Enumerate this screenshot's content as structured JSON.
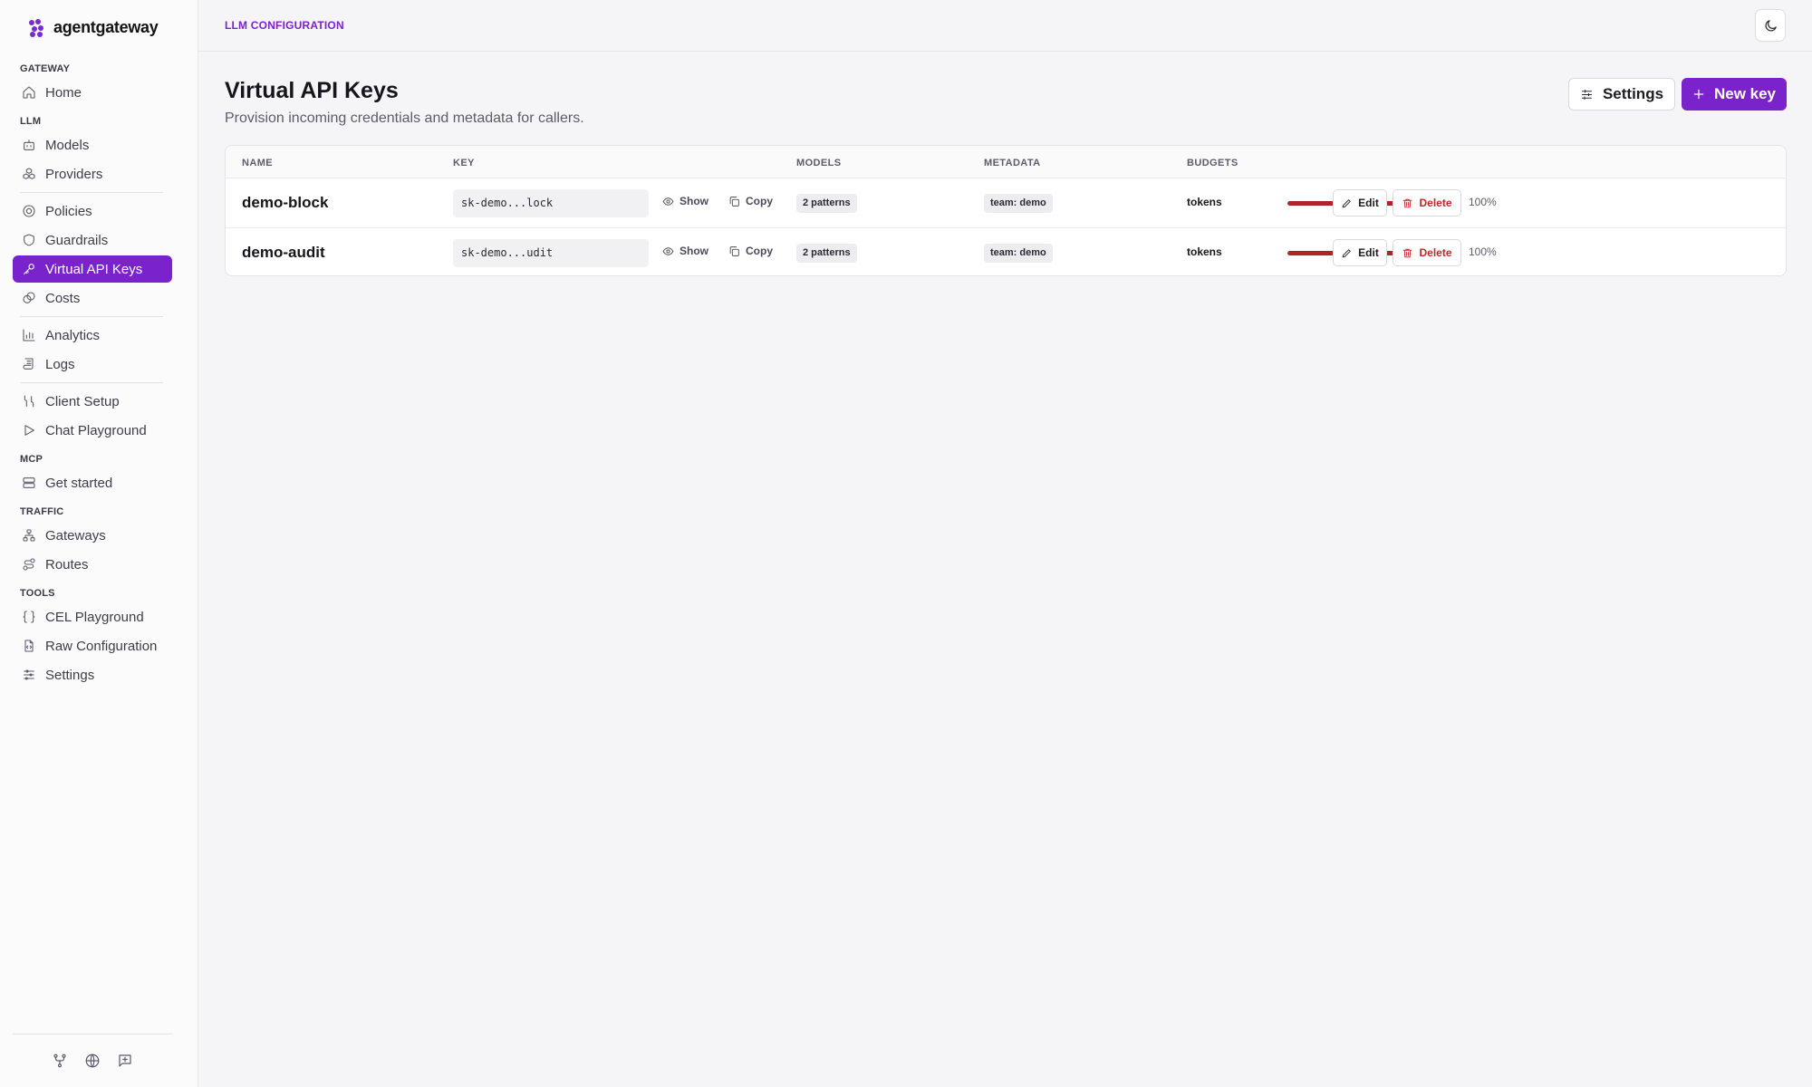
{
  "app": {
    "brand": "agentgateway"
  },
  "sidebar": {
    "sections": {
      "gateway": "GATEWAY",
      "llm": "LLM",
      "mcp": "MCP",
      "traffic": "TRAFFIC",
      "tools": "TOOLS"
    },
    "items": {
      "home": "Home",
      "models": "Models",
      "providers": "Providers",
      "policies": "Policies",
      "guardrails": "Guardrails",
      "virtual_api_keys": "Virtual API Keys",
      "costs": "Costs",
      "analytics": "Analytics",
      "logs": "Logs",
      "client_setup": "Client Setup",
      "chat_playground": "Chat Playground",
      "get_started": "Get started",
      "gateways": "Gateways",
      "routes": "Routes",
      "cel_playground": "CEL Playground",
      "raw_configuration": "Raw Configuration",
      "settings": "Settings"
    },
    "active": "virtual_api_keys",
    "footer_icons": [
      "git-fork-icon",
      "globe-icon",
      "message-plus-icon"
    ]
  },
  "topbar": {
    "breadcrumb": "LLM CONFIGURATION",
    "theme_icon": "moon-icon"
  },
  "page": {
    "title": "Virtual API Keys",
    "subtitle": "Provision incoming credentials and metadata for callers.",
    "settings_label": "Settings",
    "new_key_label": "New key"
  },
  "table": {
    "headers": {
      "name": "NAME",
      "key": "KEY",
      "models": "MODELS",
      "metadata": "METADATA",
      "budgets": "BUDGETS"
    },
    "show_label": "Show",
    "copy_label": "Copy",
    "edit_label": "Edit",
    "delete_label": "Delete",
    "rows": [
      {
        "name": "demo-block",
        "key": "sk-demo...lock",
        "models": "2 patterns",
        "metadata": "team: demo",
        "budget_label": "tokens",
        "budget_pct": 100,
        "budget_pct_text": "100%"
      },
      {
        "name": "demo-audit",
        "key": "sk-demo...udit",
        "models": "2 patterns",
        "metadata": "team: demo",
        "budget_label": "tokens",
        "budget_pct": 100,
        "budget_pct_text": "100%"
      }
    ]
  },
  "colors": {
    "accent": "#7a22cc",
    "danger": "#c0262b",
    "budget_bar": "#b02428"
  }
}
